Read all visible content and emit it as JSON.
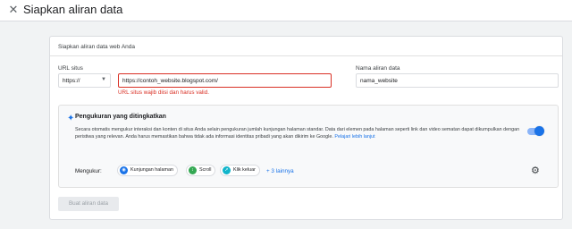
{
  "dialog": {
    "title": "Siapkan aliran data",
    "close_icon": "close-icon"
  },
  "card": {
    "header": "Siapkan aliran data web Anda"
  },
  "form": {
    "url_label": "URL situs",
    "protocol_value": "https://",
    "url_value": "https://contoh_website.blogspot.com/",
    "url_error": "URL situs wajib diisi dan harus valid.",
    "name_label": "Nama aliran data",
    "name_value": "nama_website"
  },
  "enhanced": {
    "title": "Pengukuran yang ditingkatkan",
    "description": "Secara otomatis mengukur interaksi dan konten di situs Anda selain pengukuran jumlah kunjungan halaman standar. Data dari elemen pada halaman seperti link dan video sematan dapat dikumpulkan dengan peristiwa yang relevan. Anda harus memastikan bahwa tidak ada informasi identitas pribadi yang akan dikirim ke Google.",
    "learn_more": "Pelajari lebih lanjut",
    "toggle_on": true,
    "measure_label": "Mengukur:",
    "chips": [
      {
        "label": "Kunjungan halaman",
        "icon": "eye-icon",
        "color": "#1a73e8"
      },
      {
        "label": "Scroll",
        "icon": "scroll-icon",
        "color": "#34a853"
      },
      {
        "label": "Klik keluar",
        "icon": "cursor-icon",
        "color": "#12b5cb"
      }
    ],
    "more": "+ 3 lainnya",
    "settings_icon": "gear-icon"
  },
  "actions": {
    "create_label": "Buat aliran data"
  },
  "colors": {
    "accent": "#1a73e8",
    "error": "#d93025"
  }
}
